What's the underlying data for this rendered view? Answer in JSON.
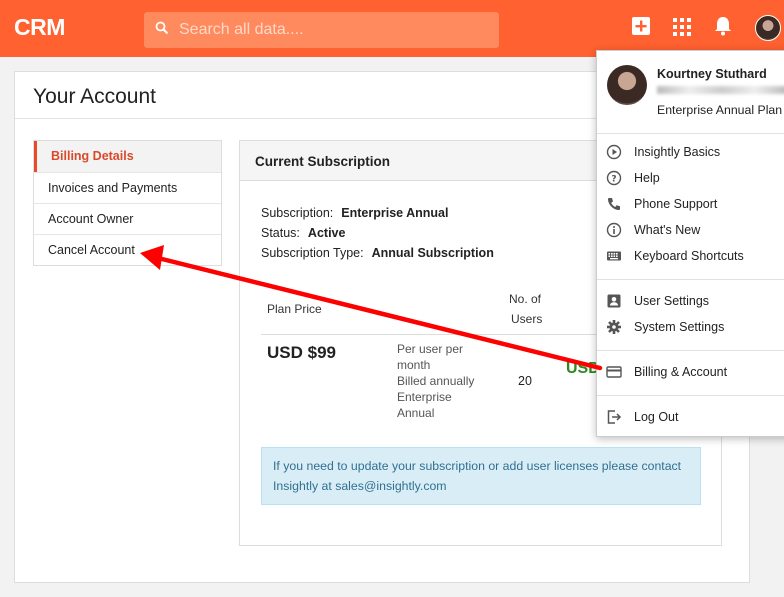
{
  "app": {
    "logo": "CRM"
  },
  "search": {
    "placeholder": "Search all data...."
  },
  "account": {
    "title": "Your Account",
    "nav": [
      "Billing Details",
      "Invoices and Payments",
      "Account Owner",
      "Cancel Account"
    ]
  },
  "subscription": {
    "header": "Current Subscription",
    "subscription_label": "Subscription:",
    "subscription_value": "Enterprise Annual",
    "status_label": "Status:",
    "status_value": "Active",
    "type_label": "Subscription Type:",
    "type_value": "Annual Subscription",
    "col_plan_price": "Plan Price",
    "col_users_line1": "No. of",
    "col_users_line2": "Users",
    "price": "USD $99",
    "desc": [
      "Per user per",
      "month",
      "Billed annually",
      "Enterprise",
      "Annual"
    ],
    "users": "20",
    "total_partial": "USD",
    "info": "If you need to update your subscription or add user licenses please contact Insightly at sales@insightly.com"
  },
  "user_menu": {
    "name": "Kourtney Stuthard",
    "plan": "Enterprise Annual Plan",
    "items": [
      "Insightly Basics",
      "Help",
      "Phone Support",
      "What's New",
      "Keyboard Shortcuts",
      "User Settings",
      "System Settings",
      "Billing & Account",
      "Log Out"
    ]
  },
  "colors": {
    "brand": "#ff6130",
    "accent_red": "#e84b2b",
    "arrow": "#ff0000",
    "success": "#2a8a1e"
  },
  "icons": [
    "search-icon",
    "add-icon",
    "apps-grid-icon",
    "bell-icon",
    "avatar"
  ]
}
